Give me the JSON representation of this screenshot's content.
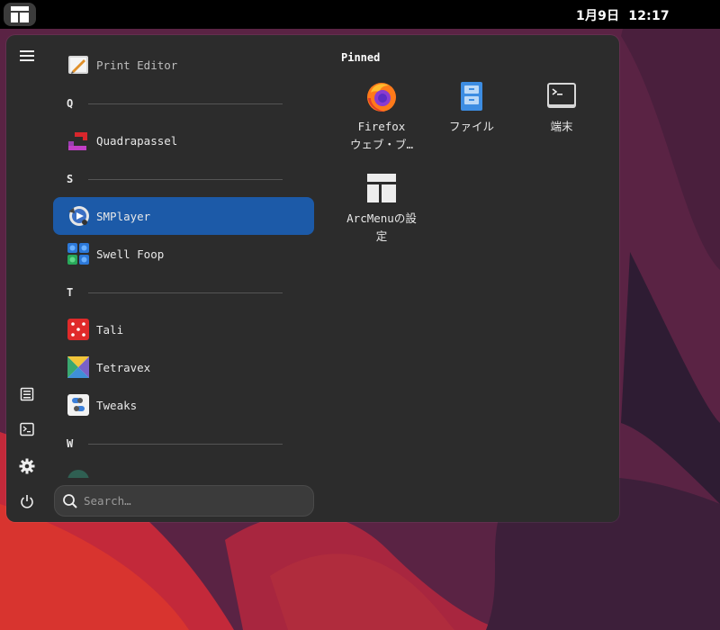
{
  "topbar": {
    "date": "1月9日",
    "time": "12:17"
  },
  "menu": {
    "apps": [
      {
        "type": "app",
        "label": "Print Editor",
        "icon": "print-editor-icon"
      },
      {
        "type": "header",
        "label": "Q"
      },
      {
        "type": "app",
        "label": "Quadrapassel",
        "icon": "quadrapassel-icon"
      },
      {
        "type": "header",
        "label": "S"
      },
      {
        "type": "app",
        "label": "SMPlayer",
        "icon": "smplayer-icon",
        "selected": true
      },
      {
        "type": "app",
        "label": "Swell Foop",
        "icon": "swell-foop-icon"
      },
      {
        "type": "header",
        "label": "T"
      },
      {
        "type": "app",
        "label": "Tali",
        "icon": "tali-icon"
      },
      {
        "type": "app",
        "label": "Tetravex",
        "icon": "tetravex-icon"
      },
      {
        "type": "app",
        "label": "Tweaks",
        "icon": "tweaks-icon"
      },
      {
        "type": "header",
        "label": "W"
      }
    ],
    "search_placeholder": "Search…",
    "pinned_title": "Pinned",
    "pinned": [
      {
        "line1": "Firefox",
        "line2": "ウェブ・ブ…",
        "icon": "firefox-icon"
      },
      {
        "line1": "ファイル",
        "line2": "",
        "icon": "files-icon"
      },
      {
        "line1": "端末",
        "line2": "",
        "icon": "terminal-icon"
      },
      {
        "line1": "ArcMenuの設",
        "line2": "定",
        "icon": "arcmenu-settings-icon"
      }
    ],
    "side_buttons": [
      "hamburger-icon",
      "documents-icon",
      "terminal-icon",
      "settings-icon",
      "power-icon"
    ],
    "accent_color": "#1c5aa8"
  }
}
